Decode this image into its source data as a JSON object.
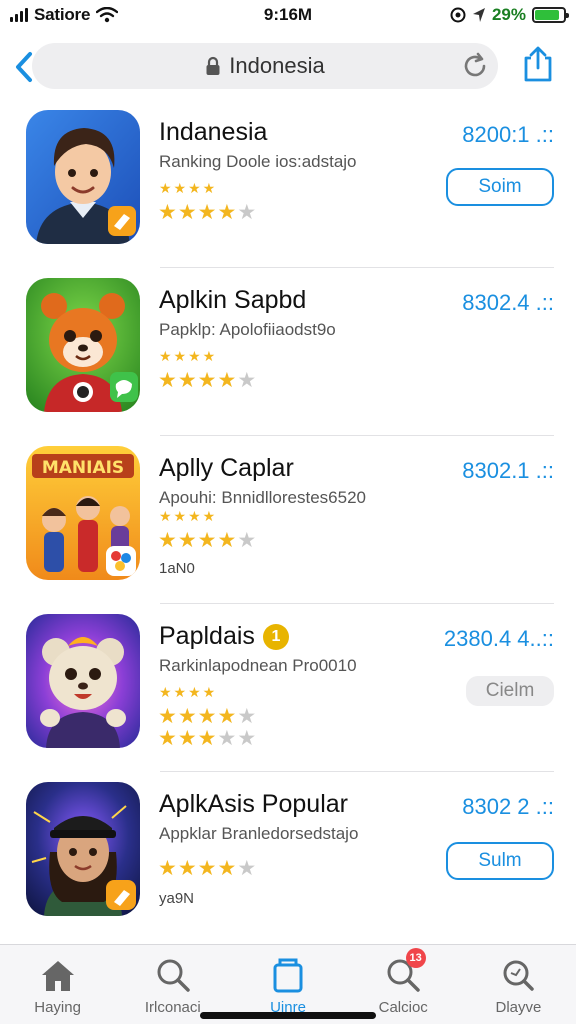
{
  "status_bar": {
    "carrier": "Satiore",
    "time": "9:16M",
    "battery_pct": "29%",
    "battery_level": 0.85
  },
  "navbar": {
    "address": "Indonesia"
  },
  "apps": [
    {
      "title": "Indanesia",
      "subtitle": "Ranking Doole ios:adstajo",
      "price": "8200:1 .::",
      "small_stars": "★★★★",
      "rating_stars": 4,
      "button_label": "Soim",
      "button_style": "outline",
      "extra": "",
      "badge": ""
    },
    {
      "title": "Aplkin Sapbd",
      "subtitle": "Papklp: Apolofiiaodst9o",
      "price": "8302.4 .::",
      "small_stars": "★★★★",
      "rating_stars": 4,
      "button_label": "",
      "button_style": "none",
      "extra": "",
      "badge": ""
    },
    {
      "title": "Aplly Caplar",
      "subtitle": "Apouhi: Bnnidllorestes6520",
      "price": "8302.1 .::",
      "small_stars": "★★★★",
      "rating_stars": 4,
      "button_label": "",
      "button_style": "none",
      "extra": "1aN0",
      "badge": "",
      "icon_text": "MANIAIS"
    },
    {
      "title": "Papldais",
      "subtitle": "Rarkinlapodnean Pro0010",
      "price": "2380.4 4..::",
      "small_stars": "★★★★",
      "rating_stars": 4,
      "button_label": "Cielm",
      "button_style": "disabled",
      "extra": "",
      "badge": "1"
    },
    {
      "title": "AplkAsis Popular",
      "subtitle": "Appklar Branledorsedstajo",
      "price": "8302 2 .::",
      "small_stars": "",
      "rating_stars": 4,
      "button_label": "Sulm",
      "button_style": "outline",
      "extra": "ya9N",
      "badge": ""
    }
  ],
  "tabs": [
    {
      "label": "Haying",
      "icon": "home-icon",
      "active": false,
      "badge": ""
    },
    {
      "label": "Irlconaci",
      "icon": "search-icon",
      "active": false,
      "badge": ""
    },
    {
      "label": "Uinre",
      "icon": "apps-icon",
      "active": true,
      "badge": ""
    },
    {
      "label": "Calcioc",
      "icon": "search-icon",
      "active": false,
      "badge": "13"
    },
    {
      "label": "Dlayve",
      "icon": "search-icon",
      "active": false,
      "badge": ""
    }
  ],
  "colors": {
    "accent": "#1a8fe0",
    "star": "#f3b61f",
    "battery": "#2fbf3a"
  }
}
